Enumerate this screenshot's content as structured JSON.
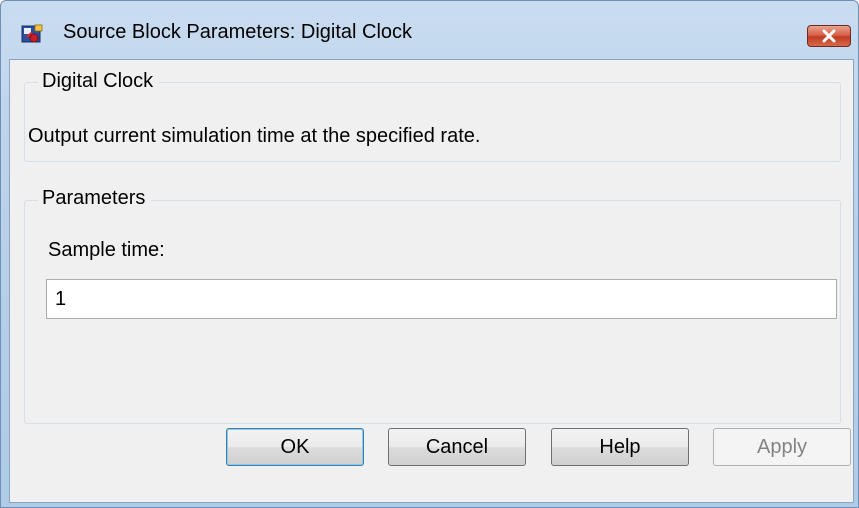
{
  "window": {
    "title": "Source Block Parameters: Digital Clock",
    "icon": "simulink-block-icon",
    "close_icon": "close-icon"
  },
  "description_group": {
    "label": "Digital Clock",
    "text": "Output current simulation time at the specified rate."
  },
  "parameters_group": {
    "label": "Parameters",
    "sample_time_label": "Sample time:",
    "sample_time_value": "1"
  },
  "buttons": {
    "ok": "OK",
    "cancel": "Cancel",
    "help": "Help",
    "apply": "Apply"
  }
}
